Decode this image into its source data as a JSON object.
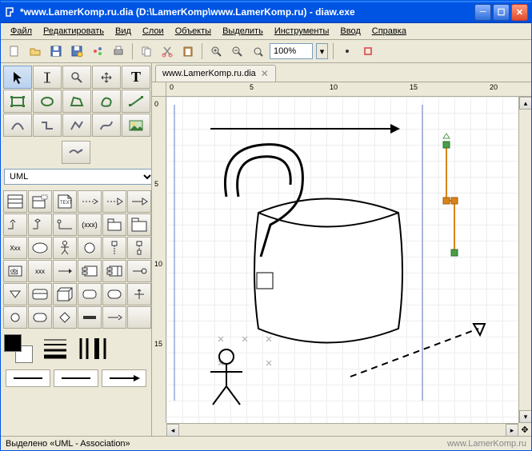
{
  "window": {
    "title": "*www.LamerKomp.ru.dia (D:\\LamerKomp\\www.LamerKomp.ru) - diaw.exe"
  },
  "menu": {
    "file": "Файл",
    "edit": "Редактировать",
    "view": "Вид",
    "layers": "Слои",
    "objects": "Объекты",
    "select": "Выделить",
    "tools": "Инструменты",
    "input": "Ввод",
    "help": "Справка"
  },
  "toolbar": {
    "zoom_value": "100%"
  },
  "category": {
    "selected": "UML"
  },
  "tabs": {
    "doc1": "www.LamerKomp.ru.dia"
  },
  "ruler": {
    "h0": "0",
    "h5": "5",
    "h10": "10",
    "h15": "15",
    "h20": "20",
    "v0": "0",
    "v5": "5",
    "v10": "10",
    "v15": "15"
  },
  "status": {
    "text": "Выделено «UML - Association»"
  },
  "watermark": "www.LamerKomp.ru"
}
